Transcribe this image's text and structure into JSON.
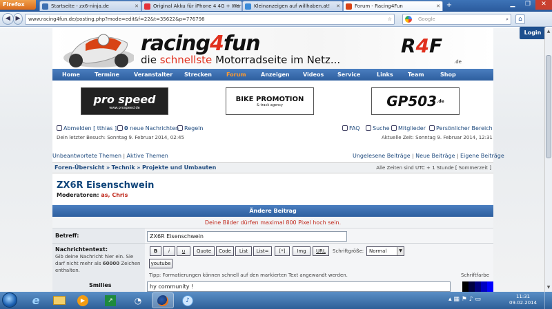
{
  "browser": {
    "menu_label": "Firefox",
    "tabs": [
      {
        "label": "Startseite - zx6-ninja.de",
        "fav_color": "#3c6fb1"
      },
      {
        "label": "Original Akku für iPhone 4 4G + Werk...",
        "fav_color": "#e53238"
      },
      {
        "label": "Kleinanzeigen auf willhaben.at!",
        "fav_color": "#3b8ad8"
      },
      {
        "label": "Forum - Racing4Fun",
        "fav_color": "#d84315"
      }
    ],
    "new_tab": "+",
    "url": "www.racing4fun.de/posting.php?mode=edit&f=22&t=35622&p=776798",
    "search_placeholder": "Google"
  },
  "login_label": "Login",
  "banner": {
    "logo_a": "racing",
    "logo_four": "4",
    "logo_b": "fun",
    "tagline_a": "die",
    "tagline_hl": "schnellste",
    "tagline_b": "Motorradseite im Netz...",
    "r4f_a": "R",
    "r4f_four": "4",
    "r4f_b": "F",
    "r4f_sub": ".de"
  },
  "nav": [
    "Home",
    "Termine",
    "Veranstalter",
    "Strecken",
    "Forum",
    "Anzeigen",
    "Videos",
    "Service",
    "Links",
    "Team",
    "Shop"
  ],
  "nav_active": "Forum",
  "sponsors": [
    "pro speed",
    "BIKE PROMOTION",
    "GP503"
  ],
  "sponsor2_sub": "& track agency",
  "sponsor1_sub": "www.prospeed.de",
  "sponsor3_sub": ".de",
  "userbar": {
    "logout": "Abmelden [ tthias ]",
    "messages_count": "0",
    "messages": "neue Nachrichten",
    "rules": "Regeln",
    "last_visit": "Dein letzter Besuch: Sonntag 9. Februar 2014, 02:45",
    "faq": "FAQ",
    "search": "Suche",
    "members": "Mitglieder",
    "personal": "Persönlicher Bereich",
    "current_time": "Aktuelle Zeit: Sonntag 9. Februar 2014, 12:31"
  },
  "quicklinks": {
    "unanswered": "Unbeantwortete Themen",
    "active": "Aktive Themen",
    "unread": "Ungelesene Beiträge",
    "new_posts": "Neue Beiträge",
    "own_posts": "Eigene Beiträge",
    "sep": "|"
  },
  "breadcrumb": {
    "items": [
      "Foren-Übersicht",
      "Technik",
      "Projekte und Umbauten"
    ],
    "sep": "»",
    "timezone": "Alle Zeiten sind UTC + 1 Stunde [ Sommerzeit ]"
  },
  "topic": {
    "title": "ZX6R Eisenschwein",
    "moderators_label": "Moderatoren:",
    "moderators": "as, Chris"
  },
  "form": {
    "header": "Ändere Beitrag",
    "notice": "Deine Bilder dürfen maximal 800 Pixel hoch sein.",
    "subject_label": "Betreff:",
    "subject_value": "ZX6R Eisenschwein",
    "message_label": "Nachrichtentext:",
    "message_help_a": "Gib deine Nachricht hier ein. Sie darf nicht mehr als",
    "message_help_num": "60000",
    "message_help_b": "Zeichen enthalten.",
    "smilies_label": "Smilies",
    "bbcode_buttons": [
      "B",
      "i",
      "u",
      "Quote",
      "Code",
      "List",
      "List=",
      "[*]",
      "Img",
      "URL"
    ],
    "youtube_button": "youtube",
    "font_size_label": "Schriftgröße:",
    "font_size_value": "Normal",
    "tip": "Tipp: Formatierungen können schnell auf den markierten Text angewandt werden.",
    "font_color_label": "Schriftfarbe",
    "message_value": "hy community !",
    "palette": [
      "#000000",
      "#000040",
      "#000080",
      "#0000c0",
      "#0000ff"
    ]
  },
  "taskbar": {
    "clock_time": "11:31",
    "clock_date": "09.02.2014"
  }
}
